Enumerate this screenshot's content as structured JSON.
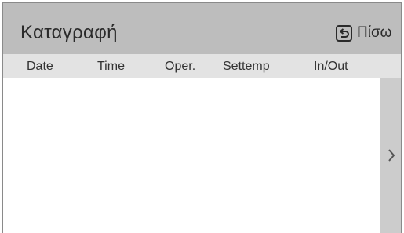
{
  "header": {
    "title": "Καταγραφή",
    "back_label": "Πίσω",
    "back_icon": "back-arrow-icon"
  },
  "columns": [
    "Date",
    "Time",
    "Oper.",
    "Settemp",
    "In/Out"
  ],
  "rows": [],
  "scroll": {
    "icon": "chevron-right-icon"
  },
  "colors": {
    "header_bg": "#bdbdbd",
    "column_header_bg": "#e3e3e3",
    "scroll_panel_bg": "#cccccc",
    "text": "#2a2a2a"
  }
}
